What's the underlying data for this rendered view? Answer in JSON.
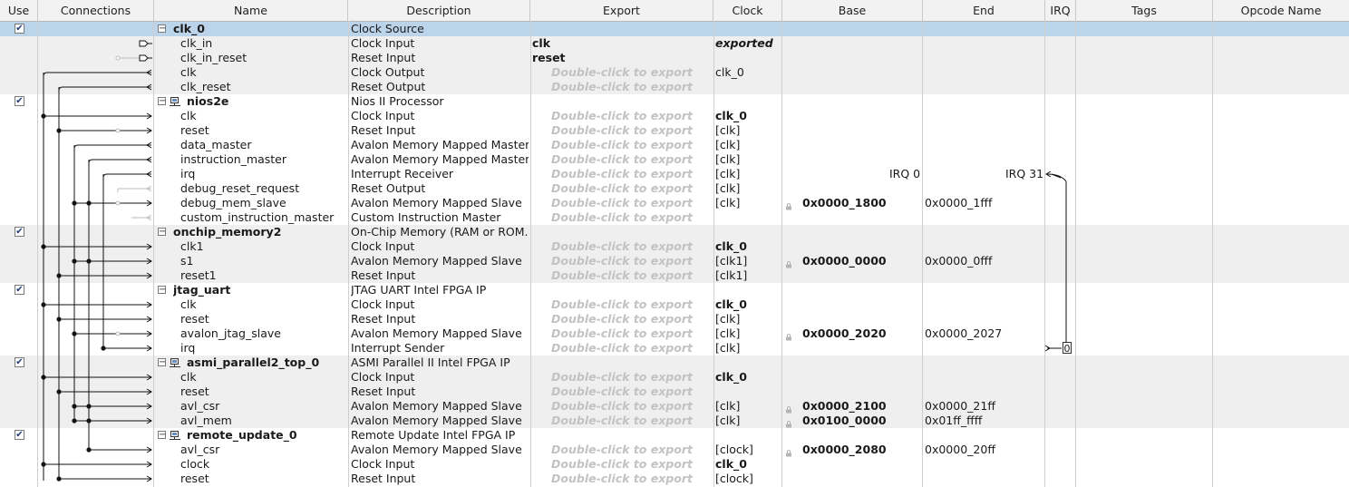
{
  "columns": {
    "use": "Use",
    "connections": "Connections",
    "name": "Name",
    "description": "Description",
    "export": "Export",
    "clock": "Clock",
    "base": "Base",
    "end": "End",
    "irq": "IRQ",
    "tags": "Tags",
    "opcode": "Opcode Name"
  },
  "checkmark": "✔",
  "rows": [
    {
      "type": "module",
      "name": "clk_0",
      "desc": "Clock Source",
      "export": "",
      "export_style": "",
      "clock": "",
      "clock_style": "",
      "base": "",
      "end": "",
      "selected": true
    },
    {
      "type": "port",
      "name": "clk_in",
      "desc": "Clock Input",
      "export": "clk",
      "export_style": "bold",
      "clock": "exported",
      "clock_style": "bi",
      "base": "",
      "end": ""
    },
    {
      "type": "port",
      "name": "clk_in_reset",
      "desc": "Reset Input",
      "export": "reset",
      "export_style": "bold",
      "clock": "",
      "clock_style": "",
      "base": "",
      "end": ""
    },
    {
      "type": "port",
      "name": "clk",
      "desc": "Clock Output",
      "export": "Double-click to export",
      "export_style": "dim",
      "clock": "clk_0",
      "clock_style": "",
      "base": "",
      "end": ""
    },
    {
      "type": "port",
      "name": "clk_reset",
      "desc": "Reset Output",
      "export": "Double-click to export",
      "export_style": "dim",
      "clock": "",
      "clock_style": "",
      "base": "",
      "end": ""
    },
    {
      "type": "module",
      "name": "nios2e",
      "desc": "Nios II Processor",
      "export": "",
      "export_style": "",
      "clock": "",
      "clock_style": "",
      "base": "",
      "end": "",
      "cpu": true
    },
    {
      "type": "port",
      "name": "clk",
      "desc": "Clock Input",
      "export": "Double-click to export",
      "export_style": "dim",
      "clock": "clk_0",
      "clock_style": "bold",
      "base": "",
      "end": ""
    },
    {
      "type": "port",
      "name": "reset",
      "desc": "Reset Input",
      "export": "Double-click to export",
      "export_style": "dim",
      "clock": "[clk]",
      "clock_style": "",
      "base": "",
      "end": ""
    },
    {
      "type": "port",
      "name": "data_master",
      "desc": "Avalon Memory Mapped Master",
      "export": "Double-click to export",
      "export_style": "dim",
      "clock": "[clk]",
      "clock_style": "",
      "base": "",
      "end": ""
    },
    {
      "type": "port",
      "name": "instruction_master",
      "desc": "Avalon Memory Mapped Master",
      "export": "Double-click to export",
      "export_style": "dim",
      "clock": "[clk]",
      "clock_style": "",
      "base": "",
      "end": ""
    },
    {
      "type": "port",
      "name": "irq",
      "desc": "Interrupt Receiver",
      "export": "Double-click to export",
      "export_style": "dim",
      "clock": "[clk]",
      "clock_style": "",
      "base": "",
      "end": "IRQ 0",
      "irq": "IRQ 31"
    },
    {
      "type": "port",
      "name": "debug_reset_request",
      "desc": "Reset Output",
      "export": "Double-click to export",
      "export_style": "dim",
      "clock": "[clk]",
      "clock_style": "",
      "base": "",
      "end": ""
    },
    {
      "type": "port",
      "name": "debug_mem_slave",
      "desc": "Avalon Memory Mapped Slave",
      "export": "Double-click to export",
      "export_style": "dim",
      "clock": "[clk]",
      "clock_style": "",
      "base": "0x0000_1800",
      "end": "0x0000_1fff"
    },
    {
      "type": "port",
      "name": "custom_instruction_master",
      "desc": "Custom Instruction Master",
      "export": "Double-click to export",
      "export_style": "dim",
      "clock": "",
      "clock_style": "",
      "base": "",
      "end": ""
    },
    {
      "type": "module",
      "name": "onchip_memory2",
      "desc": "On-Chip Memory (RAM or ROM...",
      "export": "",
      "export_style": "",
      "clock": "",
      "clock_style": "",
      "base": "",
      "end": ""
    },
    {
      "type": "port",
      "name": "clk1",
      "desc": "Clock Input",
      "export": "Double-click to export",
      "export_style": "dim",
      "clock": "clk_0",
      "clock_style": "bold",
      "base": "",
      "end": ""
    },
    {
      "type": "port",
      "name": "s1",
      "desc": "Avalon Memory Mapped Slave",
      "export": "Double-click to export",
      "export_style": "dim",
      "clock": "[clk1]",
      "clock_style": "",
      "base": "0x0000_0000",
      "end": "0x0000_0fff"
    },
    {
      "type": "port",
      "name": "reset1",
      "desc": "Reset Input",
      "export": "Double-click to export",
      "export_style": "dim",
      "clock": "[clk1]",
      "clock_style": "",
      "base": "",
      "end": ""
    },
    {
      "type": "module",
      "name": "jtag_uart",
      "desc": "JTAG UART Intel FPGA IP",
      "export": "",
      "export_style": "",
      "clock": "",
      "clock_style": "",
      "base": "",
      "end": ""
    },
    {
      "type": "port",
      "name": "clk",
      "desc": "Clock Input",
      "export": "Double-click to export",
      "export_style": "dim",
      "clock": "clk_0",
      "clock_style": "bold",
      "base": "",
      "end": ""
    },
    {
      "type": "port",
      "name": "reset",
      "desc": "Reset Input",
      "export": "Double-click to export",
      "export_style": "dim",
      "clock": "[clk]",
      "clock_style": "",
      "base": "",
      "end": ""
    },
    {
      "type": "port",
      "name": "avalon_jtag_slave",
      "desc": "Avalon Memory Mapped Slave",
      "export": "Double-click to export",
      "export_style": "dim",
      "clock": "[clk]",
      "clock_style": "",
      "base": "0x0000_2020",
      "end": "0x0000_2027"
    },
    {
      "type": "port",
      "name": "irq",
      "desc": "Interrupt Sender",
      "export": "Double-click to export",
      "export_style": "dim",
      "clock": "[clk]",
      "clock_style": "",
      "base": "",
      "end": "",
      "irq_num": "0"
    },
    {
      "type": "module",
      "name": "asmi_parallel2_top_0",
      "desc": "ASMI Parallel II Intel FPGA IP",
      "export": "",
      "export_style": "",
      "clock": "",
      "clock_style": "",
      "base": "",
      "end": "",
      "cpu": true
    },
    {
      "type": "port",
      "name": "clk",
      "desc": "Clock Input",
      "export": "Double-click to export",
      "export_style": "dim",
      "clock": "clk_0",
      "clock_style": "bold",
      "base": "",
      "end": ""
    },
    {
      "type": "port",
      "name": "reset",
      "desc": "Reset Input",
      "export": "Double-click to export",
      "export_style": "dim",
      "clock": "",
      "clock_style": "",
      "base": "",
      "end": ""
    },
    {
      "type": "port",
      "name": "avl_csr",
      "desc": "Avalon Memory Mapped Slave",
      "export": "Double-click to export",
      "export_style": "dim",
      "clock": "[clk]",
      "clock_style": "",
      "base": "0x0000_2100",
      "end": "0x0000_21ff"
    },
    {
      "type": "port",
      "name": "avl_mem",
      "desc": "Avalon Memory Mapped Slave",
      "export": "Double-click to export",
      "export_style": "dim",
      "clock": "[clk]",
      "clock_style": "",
      "base": "0x0100_0000",
      "end": "0x01ff_ffff"
    },
    {
      "type": "module",
      "name": "remote_update_0",
      "desc": "Remote Update Intel FPGA IP",
      "export": "",
      "export_style": "",
      "clock": "",
      "clock_style": "",
      "base": "",
      "end": "",
      "cpu": true
    },
    {
      "type": "port",
      "name": "avl_csr",
      "desc": "Avalon Memory Mapped Slave",
      "export": "Double-click to export",
      "export_style": "dim",
      "clock": "[clock]",
      "clock_style": "",
      "base": "0x0000_2080",
      "end": "0x0000_20ff"
    },
    {
      "type": "port",
      "name": "clock",
      "desc": "Clock Input",
      "export": "Double-click to export",
      "export_style": "dim",
      "clock": "clk_0",
      "clock_style": "bold",
      "base": "",
      "end": ""
    },
    {
      "type": "port",
      "name": "reset",
      "desc": "Reset Input",
      "export": "Double-click to export",
      "export_style": "dim",
      "clock": "[clock]",
      "clock_style": "",
      "base": "",
      "end": ""
    }
  ]
}
